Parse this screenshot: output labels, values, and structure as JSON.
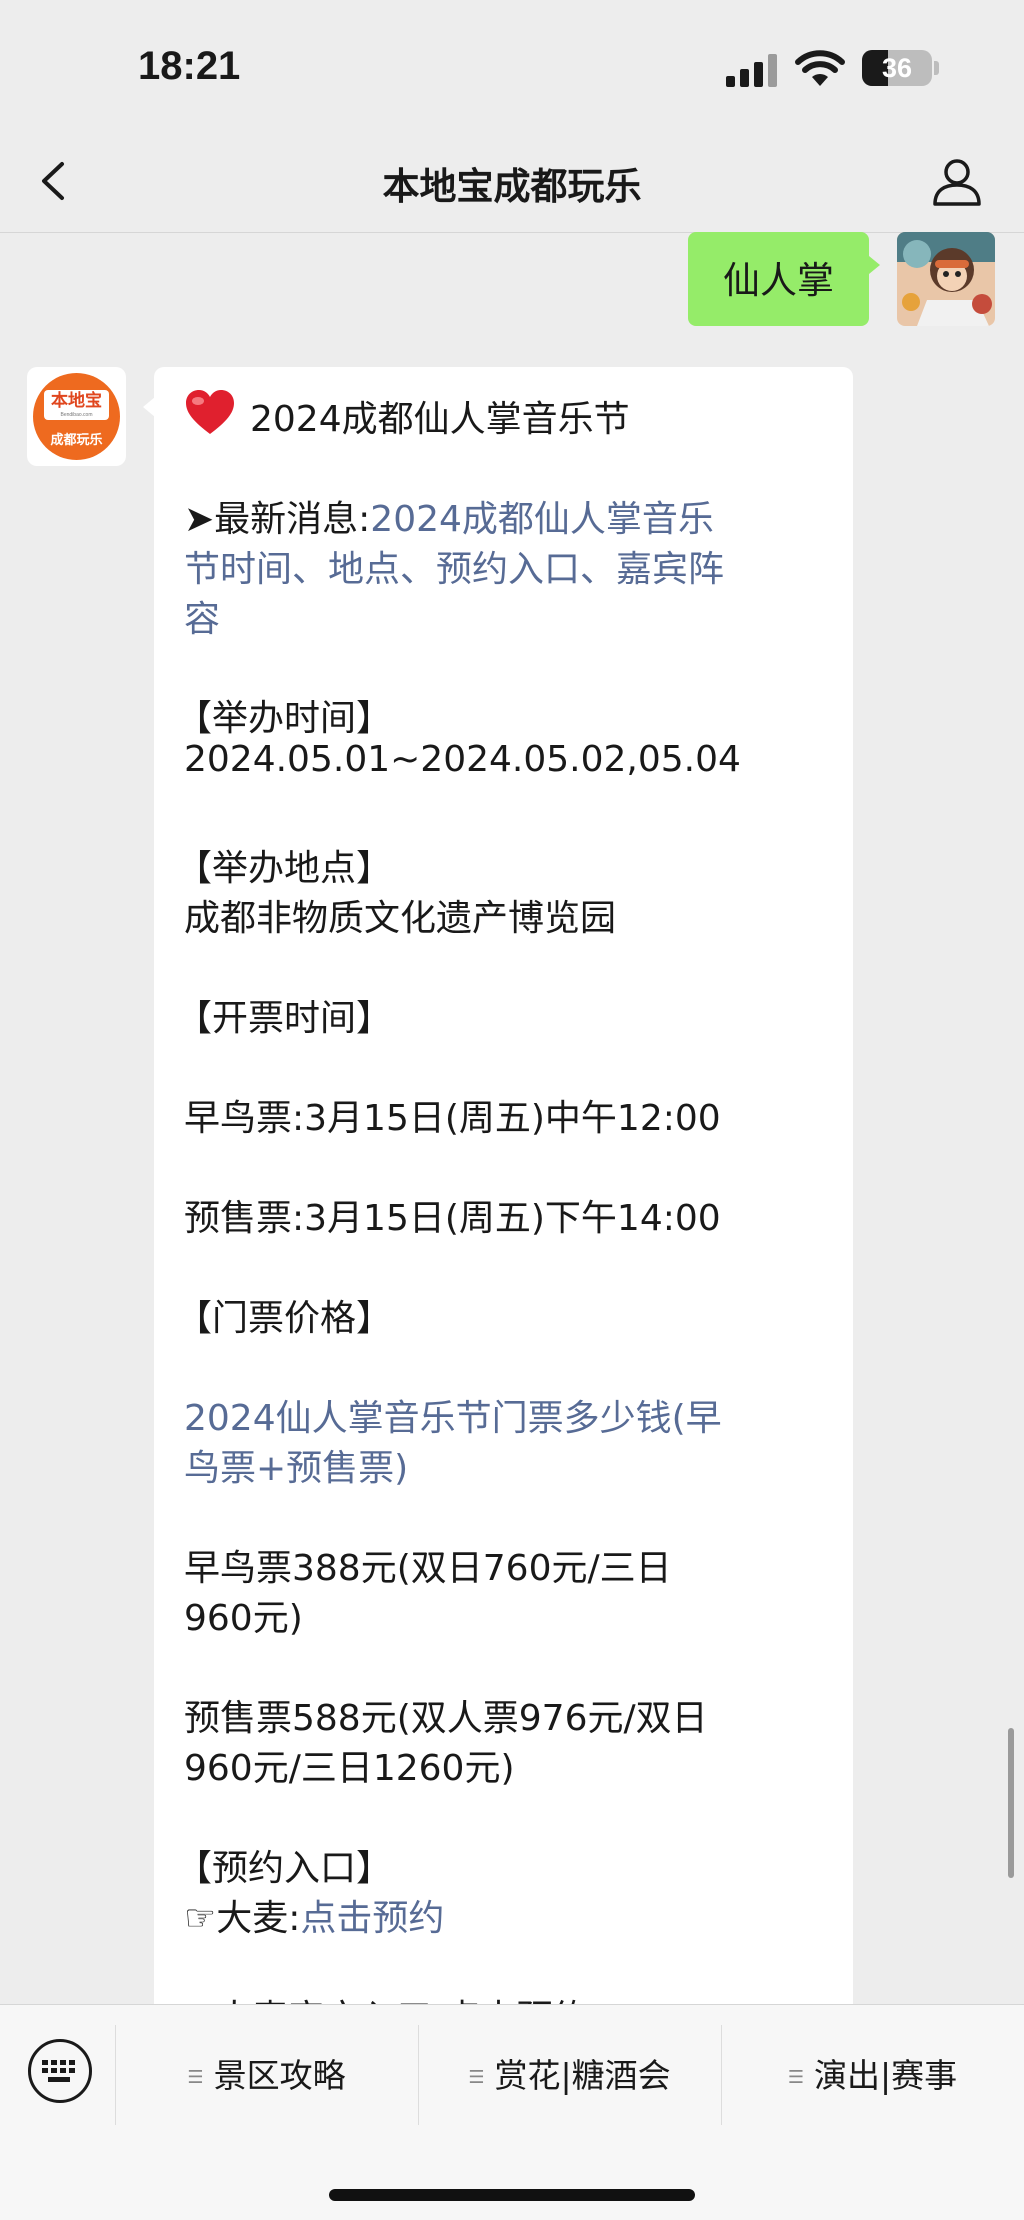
{
  "status_bar": {
    "time": "18:21",
    "battery": "36"
  },
  "nav": {
    "title": "本地宝成都玩乐"
  },
  "user_message": {
    "text": "仙人掌"
  },
  "bot_logo": {
    "cn": "本地宝",
    "en": "Bendibao.com",
    "sub": "成都玩乐"
  },
  "message": {
    "title": "2024成都仙人掌音乐节",
    "news_prefix": "➤最新消息:",
    "news_link_line1": "2024成都仙人掌音乐",
    "news_link_line2": "节时间、地点、预约入口、嘉宾阵",
    "news_link_line3": "容",
    "time_header": "【举办时间】",
    "time_value": "2024.05.01~2024.05.02,05.04",
    "place_header": "【举办地点】",
    "place_value": "成都非物质文化遗产博览园",
    "sale_header": "【开票时间】",
    "early_sale": "早鸟票:3月15日(周五)中午12:00",
    "presale": "预售票:3月15日(周五)下午14:00",
    "price_header": "【门票价格】",
    "price_link_line1": "2024仙人掌音乐节门票多少钱(早",
    "price_link_line2": "鸟票+预售票)",
    "early_price_line1": "早鸟票388元(双日760元/三日",
    "early_price_line2": "960元)",
    "presale_price_line1": "预售票588元(双人票976元/双日",
    "presale_price_line2": "960元/三日1260元)",
    "booking_header": "【预约入口】",
    "booking_prefix": "☞大麦:",
    "booking_link": "点击预约",
    "cutoff_line": "☞大麦官方入口:点击预约"
  },
  "bottom_menu": {
    "items": [
      "景区攻略",
      "赏花|糖酒会",
      "演出|赛事"
    ]
  },
  "colors": {
    "link": "#576b95",
    "user_bubble": "#95ec69",
    "brand": "#ee6a1f"
  }
}
